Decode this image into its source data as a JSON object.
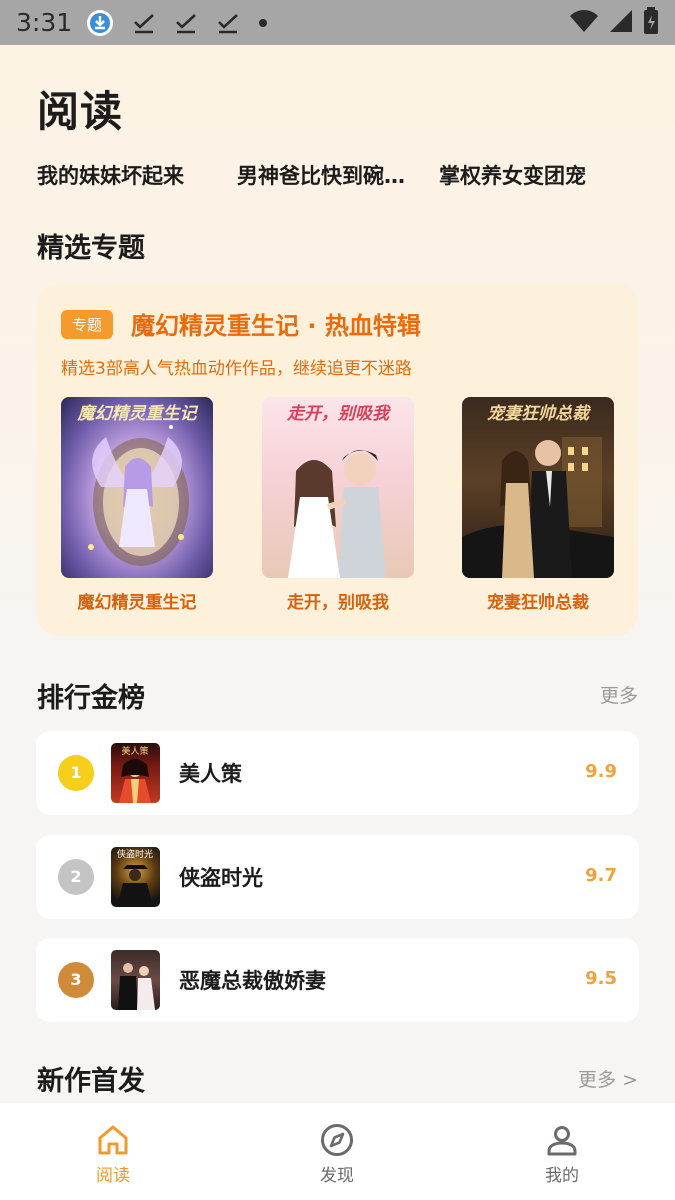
{
  "status_bar": {
    "time": "3:31",
    "icons": [
      "download-icon",
      "check-download-icon",
      "check-download-icon",
      "check-download-icon",
      "dot-icon",
      "wifi-icon",
      "signal-icon",
      "battery-icon"
    ]
  },
  "header": {
    "title": "阅读"
  },
  "ticker": {
    "items": [
      "我的妹妹坏起来",
      "男神爸比快到碗里来",
      "掌权养女变团宠"
    ]
  },
  "featured": {
    "title": "精选专题",
    "card": {
      "tag": "专题",
      "name": "魔幻精灵重生记 · 热血特辑",
      "subtitle": "精选3部高人气热血动作作品，继续追更不迷路",
      "books": [
        {
          "name": "魔幻精灵重生记",
          "cover_text": "魔幻精灵重生记"
        },
        {
          "name": "走开，别吸我",
          "cover_text": "走开，别吸我"
        },
        {
          "name": "宠妻狂帅总裁",
          "cover_text": "宠妻狂帅总裁"
        }
      ]
    }
  },
  "ranking": {
    "title": "排行金榜",
    "more": "更多",
    "items": [
      {
        "rank": "1",
        "title": "美人策",
        "score": "9.9",
        "badge_color": "#f6cf1a"
      },
      {
        "rank": "2",
        "title": "侠盗时光",
        "score": "9.7",
        "badge_color": "#c4c4c4"
      },
      {
        "rank": "3",
        "title": "恶魔总裁傲娇妻",
        "score": "9.5",
        "badge_color": "#cf8a3a"
      }
    ]
  },
  "new_releases": {
    "title": "新作首发",
    "more": "更多 >"
  },
  "tabbar": {
    "tabs": [
      {
        "label": "阅读",
        "icon": "home-icon",
        "active": true
      },
      {
        "label": "发现",
        "icon": "compass-icon",
        "active": false
      },
      {
        "label": "我的",
        "icon": "person-icon",
        "active": false
      }
    ]
  },
  "colors": {
    "accent": "#f09a2c",
    "topic_text": "#e86b0d",
    "score": "#f0a23b",
    "inactive_tab": "#6b6b6b"
  }
}
